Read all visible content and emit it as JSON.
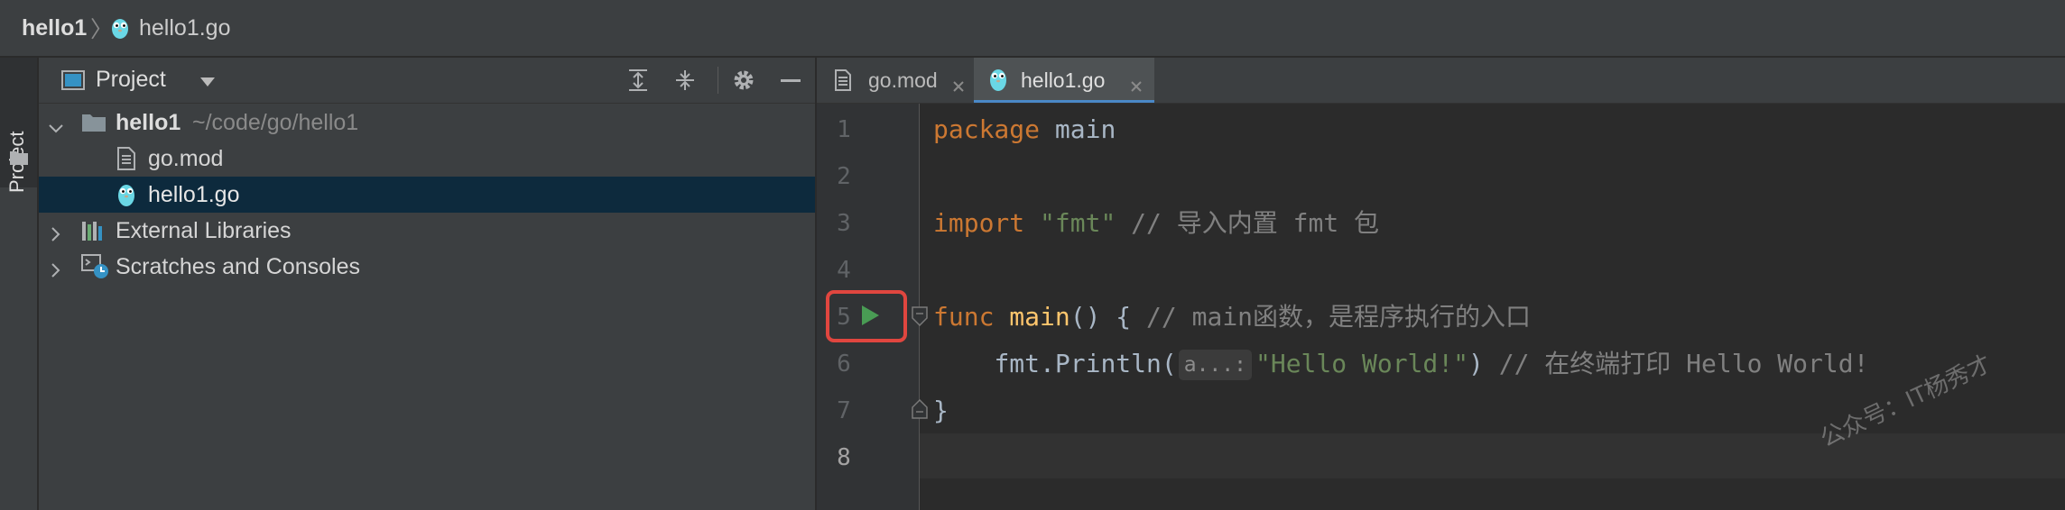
{
  "breadcrumb": {
    "project": "hello1",
    "file": "hello1.go"
  },
  "side_tab": {
    "label": "Project"
  },
  "project_panel": {
    "title": "Project",
    "tree": [
      {
        "name": "hello1",
        "path": "~/code/go/hello1",
        "type": "folder",
        "expanded": true
      },
      {
        "name": "go.mod",
        "type": "file"
      },
      {
        "name": "hello1.go",
        "type": "go-file",
        "selected": true
      },
      {
        "name": "External Libraries",
        "type": "libraries",
        "expanded": false
      },
      {
        "name": "Scratches and Consoles",
        "type": "scratches",
        "expanded": false
      }
    ]
  },
  "tabs": [
    {
      "label": "go.mod",
      "active": false
    },
    {
      "label": "hello1.go",
      "active": true
    }
  ],
  "editor": {
    "line_numbers": [
      "1",
      "2",
      "3",
      "4",
      "5",
      "6",
      "7",
      "8"
    ],
    "current_line": 8,
    "code": {
      "l1_kw": "package",
      "l1_name": " main",
      "l3_kw": "import",
      "l3_str": " \"fmt\"",
      "l3_cm": " // 导入内置 fmt 包",
      "l5_kw": "func",
      "l5_fn": " main",
      "l5_rest": "() { ",
      "l5_cm": "// main函数，是程序执行的入口",
      "l6_indent": "    ",
      "l6_call": "fmt.Println(",
      "l6_hint": "a...:",
      "l6_str": "\"Hello World!\"",
      "l6_close": ")",
      "l6_cm": " // 在终端打印 Hello World!",
      "l7": "}"
    }
  },
  "watermark": "公众号：IT杨秀才",
  "colors": {
    "keyword": "#cc7832",
    "function": "#ffc66d",
    "string": "#6a8759",
    "comment": "#808080",
    "run": "#499c54",
    "highlight": "#e0463f",
    "selection": "#0d2a3d"
  }
}
